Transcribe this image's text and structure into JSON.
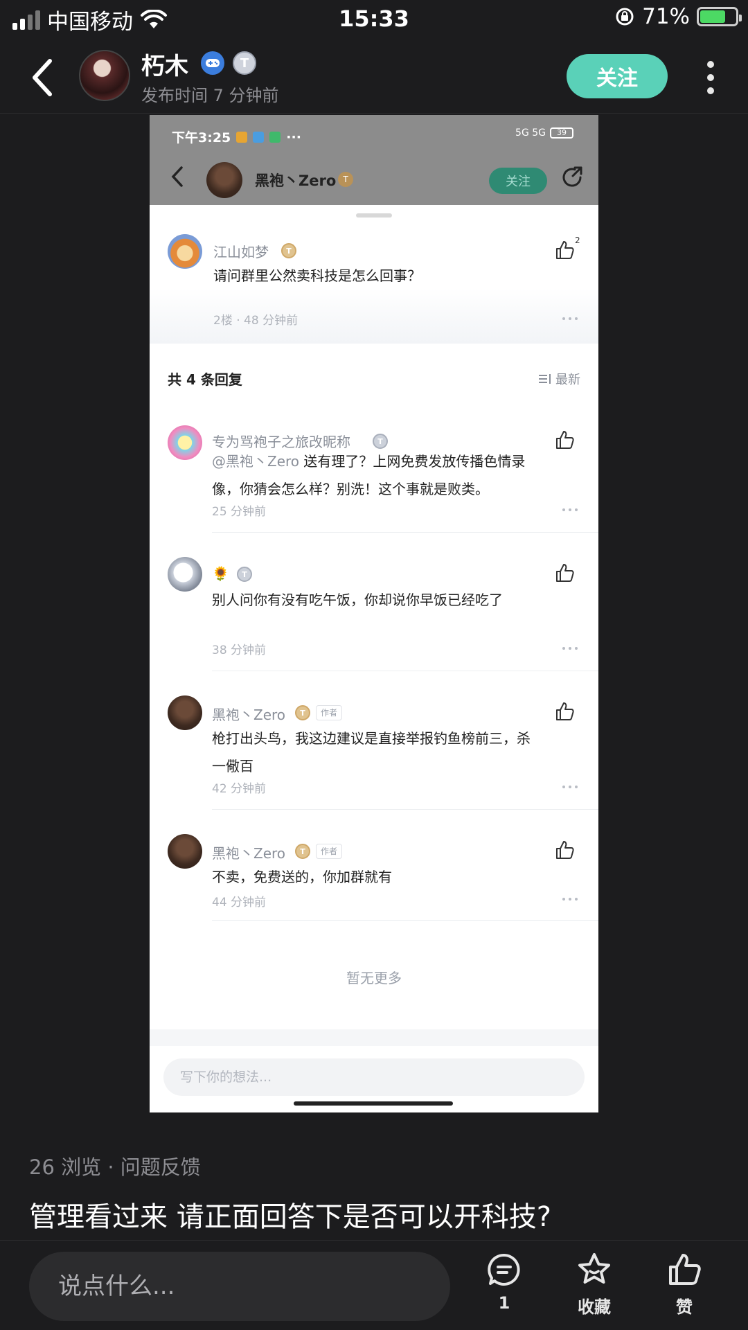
{
  "status_bar": {
    "carrier": "中国移动",
    "time": "15:33",
    "battery": "71%",
    "battery_level": 0.71
  },
  "header": {
    "author_name": "朽木",
    "badge_t": "T",
    "post_time": "发布时间 7 分钟前",
    "follow_label": "关注"
  },
  "screenshot": {
    "status_time": "下午3:25",
    "status_dots": "···",
    "network": "5G 5G",
    "battery": "39",
    "nav_name": "黑袍丶Zero",
    "nav_badge": "T",
    "nav_follow": "关注",
    "top_comment": {
      "name": "江山如梦",
      "badge": "T",
      "text": "请问群里公然卖科技是怎么回事？",
      "meta": "2楼 · 48 分钟前",
      "likes": "2"
    },
    "reply_count_label": "共 4 条回复",
    "sort_label": "最新",
    "replies": [
      {
        "name": "专为骂袍子之旅改昵称",
        "badge": "T",
        "mention": "@黑袍丶Zero",
        "text": "送有理了？上网免费发放传播色情录",
        "text2": "像，你猜会怎么样？别洗！这个事就是败类。",
        "meta": "25 分钟前"
      },
      {
        "name": "🌻",
        "badge": "T",
        "text": "别人问你有没有吃午饭，你却说你早饭已经吃了",
        "meta": "38 分钟前"
      },
      {
        "name": "黑袍丶Zero",
        "badge": "T",
        "author_tag": "作者",
        "text": "枪打出头鸟，我这边建议是直接举报钓鱼榜前三，杀",
        "text2": "一儆百",
        "meta": "42 分钟前"
      },
      {
        "name": "黑袍丶Zero",
        "badge": "T",
        "author_tag": "作者",
        "text": "不卖，免费送的，你加群就有",
        "meta": "44 分钟前"
      }
    ],
    "no_more": "暂无更多",
    "input_placeholder": "写下你的想法..."
  },
  "post": {
    "info": "26 浏览 · 问题反馈",
    "title": "管理看过来  请正面回答下是否可以开科技?"
  },
  "bottom_bar": {
    "placeholder": "说点什么...",
    "comment_count": "1",
    "favorite_label": "收藏",
    "like_label": "赞"
  },
  "colors": {
    "accent": "#5ad1b8",
    "background": "#1c1c1e"
  }
}
